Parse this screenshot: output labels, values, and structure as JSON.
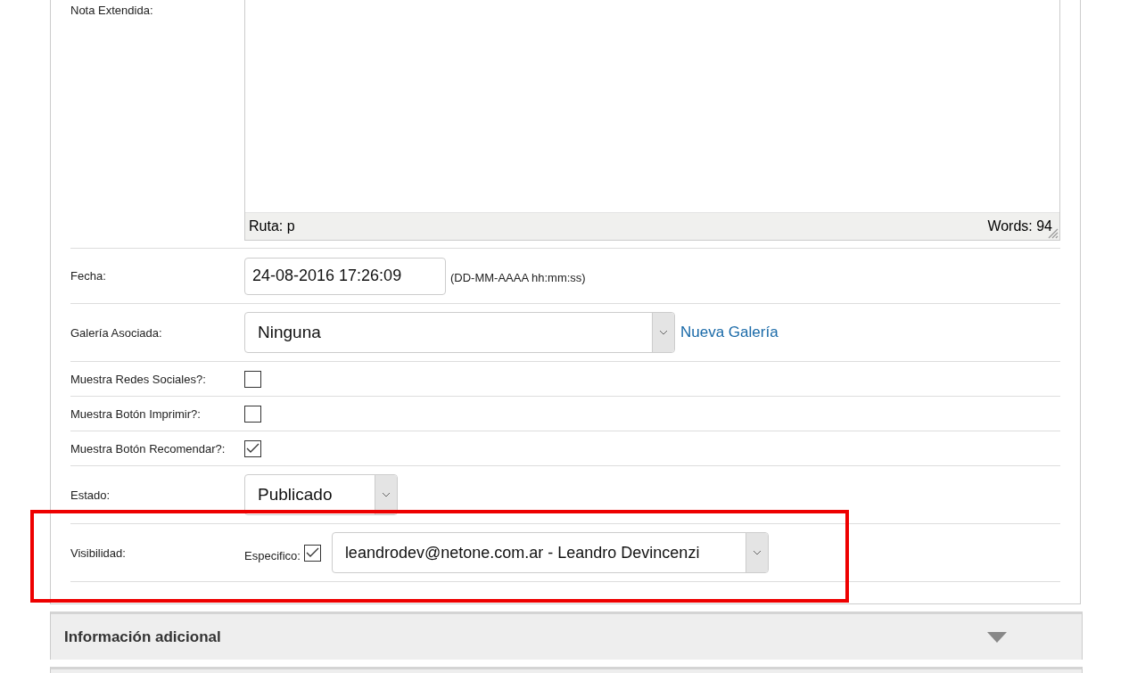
{
  "form": {
    "rows": [
      {
        "kind": "editor",
        "label": "Nota Extendida:",
        "path": "Ruta: p",
        "word_count": "Words: 94"
      },
      {
        "kind": "date",
        "label": "Fecha:",
        "value": "24-08-2016 17:26:09",
        "hint": "(DD-MM-AAAA hh:mm:ss)"
      },
      {
        "kind": "select",
        "label": "Galería Asociada:",
        "value": "Ninguna",
        "link": "Nueva Galería"
      },
      {
        "kind": "checkbox",
        "label": "Muestra Redes Sociales?:",
        "checked": false
      },
      {
        "kind": "checkbox",
        "label": "Muestra Botón Imprimir?:",
        "checked": false
      },
      {
        "kind": "checkbox",
        "label": "Muestra Botón Recomendar?:",
        "checked": true
      },
      {
        "kind": "status",
        "label": "Estado:",
        "value": "Publicado"
      },
      {
        "kind": "visibility",
        "label": "Visibilidad:",
        "option_label": "Especifico:",
        "checked": true,
        "value": "leandrodev@netone.com.ar - Leandro Devincenzi"
      }
    ]
  },
  "sections": [
    {
      "title": "Información adicional",
      "expanded": false
    }
  ]
}
